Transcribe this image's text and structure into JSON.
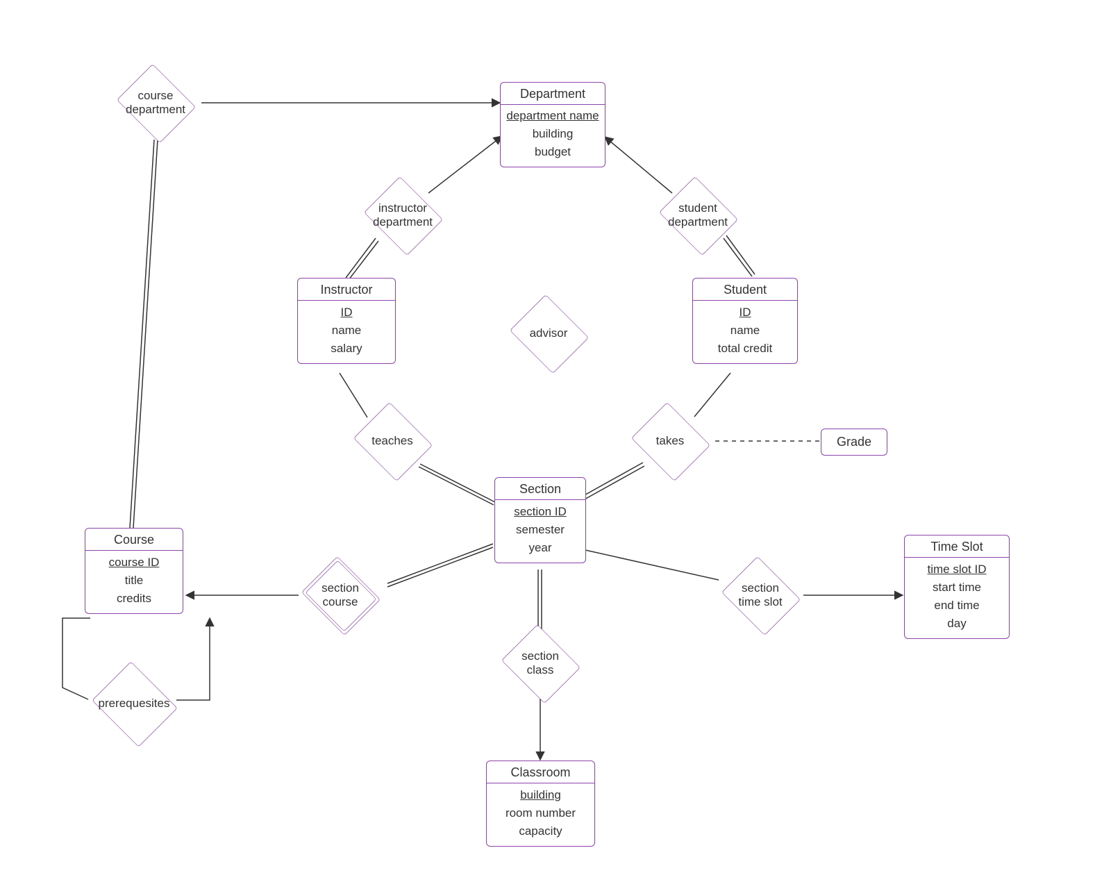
{
  "entities": {
    "department": {
      "name": "Department",
      "attrs": [
        "department name",
        "building",
        "budget"
      ],
      "keys": [
        0
      ]
    },
    "instructor": {
      "name": "Instructor",
      "attrs": [
        "ID",
        "name",
        "salary"
      ],
      "keys": [
        0
      ]
    },
    "student": {
      "name": "Student",
      "attrs": [
        "ID",
        "name",
        "total credit"
      ],
      "keys": [
        0
      ]
    },
    "section": {
      "name": "Section",
      "attrs": [
        "section ID",
        "semester",
        "year"
      ],
      "keys": [
        0
      ]
    },
    "course": {
      "name": "Course",
      "attrs": [
        "course ID",
        "title",
        "credits"
      ],
      "keys": [
        0
      ]
    },
    "classroom": {
      "name": "Classroom",
      "attrs": [
        "building",
        "room number",
        "capacity"
      ],
      "keys": [
        0
      ]
    },
    "timeslot": {
      "name": "Time Slot",
      "attrs": [
        "time slot ID",
        "start time",
        "end time",
        "day"
      ],
      "keys": [
        0
      ]
    }
  },
  "relationships": {
    "course_department": "course\ndepartment",
    "instructor_department": "instructor\ndepartment",
    "student_department": "student\ndepartment",
    "advisor": "advisor",
    "teaches": "teaches",
    "takes": "takes",
    "section_course": "section\ncourse",
    "section_class": "section\nclass",
    "section_time_slot": "section\ntime slot",
    "prerequisites": "prerequesites"
  },
  "grade": "Grade"
}
